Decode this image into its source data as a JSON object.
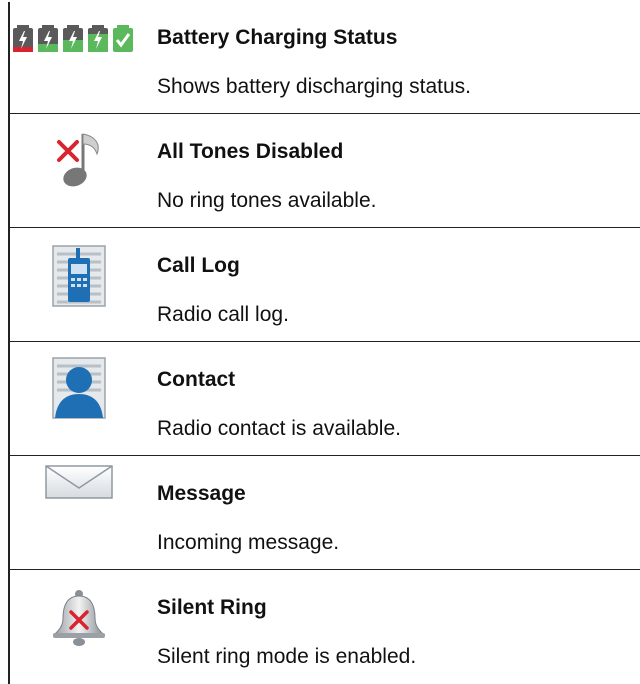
{
  "rows": [
    {
      "icon": "battery-charging-icon",
      "title": "Battery Charging Status",
      "description": "Shows battery discharging status."
    },
    {
      "icon": "tones-disabled-icon",
      "title": "All Tones Disabled",
      "description": "No ring tones available."
    },
    {
      "icon": "call-log-icon",
      "title": "Call Log",
      "description": "Radio call log."
    },
    {
      "icon": "contact-icon",
      "title": "Contact",
      "description": "Radio contact is available."
    },
    {
      "icon": "message-icon",
      "title": "Message",
      "description": "Incoming message."
    },
    {
      "icon": "silent-ring-icon",
      "title": "Silent Ring",
      "description": "Silent ring mode is enabled."
    }
  ],
  "colors": {
    "battery_green": "#5cb85c",
    "battery_red": "#d9232e",
    "error_red": "#d9232e",
    "accent_blue": "#1f6fb5",
    "border": "#222222"
  }
}
